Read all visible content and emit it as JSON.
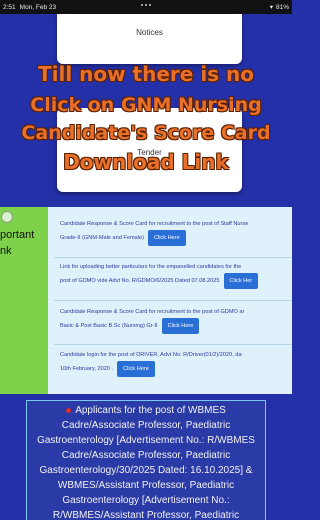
{
  "status": {
    "time": "2:51",
    "date": "Mon, Feb 23",
    "battery": "81%"
  },
  "cards": {
    "notices": "Notices",
    "second": "Tender"
  },
  "overlay": {
    "line1": "Till now there is no",
    "line2": "Click on GNM Nursing",
    "line3": "Candidate's Score Card",
    "line4": "Download Link"
  },
  "sidebar": {
    "line1": "portant",
    "line2": "nk"
  },
  "links": [
    {
      "text1": "Candidate Response & Score Card for recruitment to the post of Staff Nurse",
      "text2": "Grade-II (GNM-Male and Female)",
      "button": "Click Here"
    },
    {
      "text1": "Link for uploading better particulars for the empanelled candidates for the",
      "text2": "post of GDMO vide Advt No. R/GDMO/6/2025 Dated 07.08.2025",
      "button": "Click Her"
    },
    {
      "text1": "Candidate Response & Score Card for recruitment to the post of GDMO ar",
      "text2": "Basic & Post Basic B.Sc (Nursing) Gr-II",
      "button": "Click Here"
    },
    {
      "text1": "Candidate login for the post of DRIVER, Advt No: R/Driver(01/2)/2020, da",
      "text2": "10th February, 2020 .",
      "button": "Click Here"
    }
  ],
  "notice_box": {
    "text": "Applicants for the post of WBMES Cadre/Associate Professor, Paediatric Gastroenterology [Advertisement No.: R/WBMES Cadre/Associate Professor, Paediatric Gastroenterology/30/2025 Dated: 16.10.2025] & WBMES/Assistant Professor, Paediatric Gastroenterology [Advertisement No.: R/WBMES/Assistant Professor, Paediatric"
  }
}
